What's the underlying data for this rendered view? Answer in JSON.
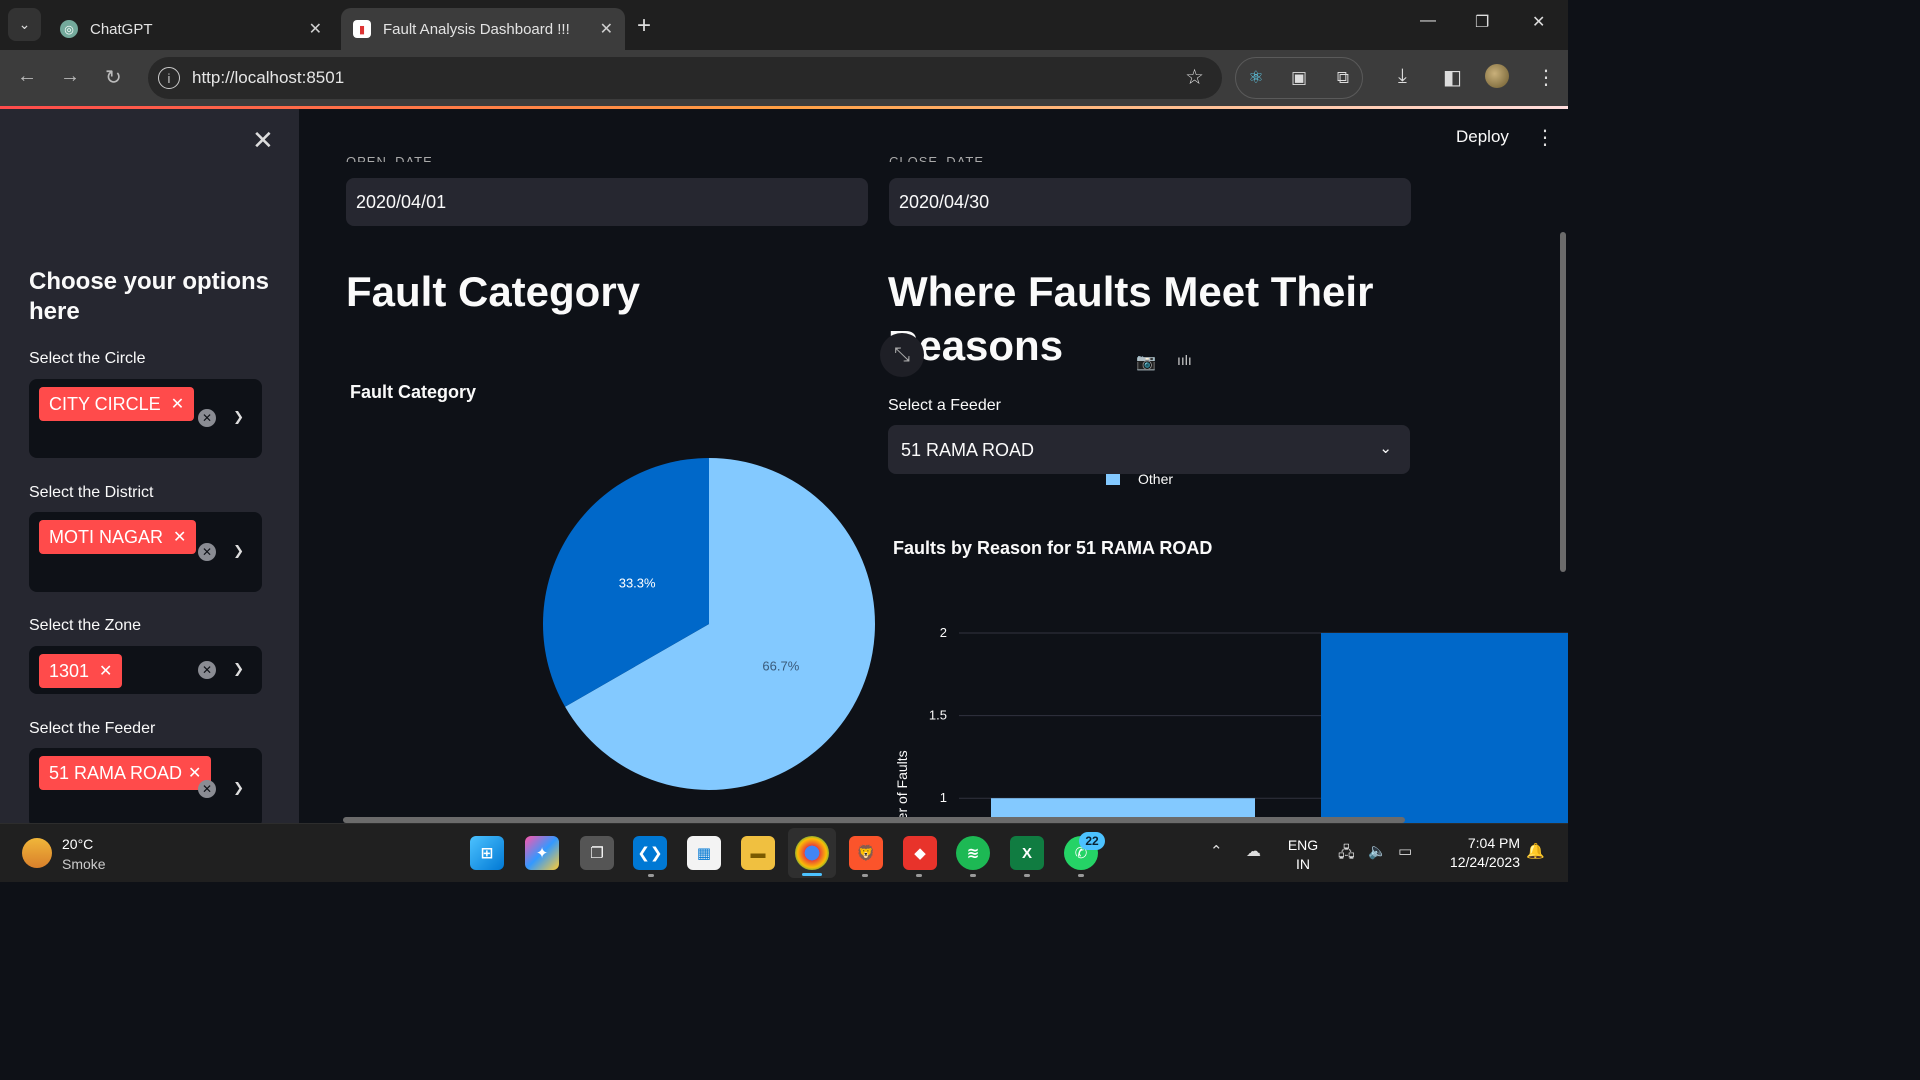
{
  "browser": {
    "tabs": [
      {
        "title": "ChatGPT",
        "icon": "chatgpt-icon"
      },
      {
        "title": "Fault Analysis Dashboard !!!",
        "icon": "bar-chart-icon"
      }
    ],
    "url": "http://localhost:8501"
  },
  "sidebar": {
    "title": "Choose your options here",
    "filters": [
      {
        "label": "Select the Circle",
        "value": "CITY CIRCLE"
      },
      {
        "label": "Select the District",
        "value": "MOTI NAGAR"
      },
      {
        "label": "Select the Zone",
        "value": "1301"
      },
      {
        "label": "Select the Feeder",
        "value": "51 RAMA ROAD"
      }
    ]
  },
  "header": {
    "deploy_label": "Deploy"
  },
  "dates": {
    "open_label": "OPEN_DATE",
    "open_value": "2020/04/01",
    "close_label": "CLOSE_DATE",
    "close_value": "2020/04/30"
  },
  "left_section": {
    "heading": "Fault Category"
  },
  "right_section": {
    "heading": "Where Faults Meet Their Reasons",
    "select_label": "Select a Feeder",
    "select_value": "51 RAMA ROAD",
    "legend_item": "Other"
  },
  "colors": {
    "accent": "#ff4b4b",
    "series_light": "#83c9ff",
    "series_dark": "#0068c9"
  },
  "chart_data": [
    {
      "type": "pie",
      "title": "Fault Category",
      "slices": [
        {
          "label": "",
          "value": 66.7,
          "text": "66.7%",
          "color": "#83c9ff"
        },
        {
          "label": "",
          "value": 33.3,
          "text": "33.3%",
          "color": "#0068c9"
        }
      ]
    },
    {
      "type": "bar",
      "title": "Faults by Reason for 51 RAMA ROAD",
      "ylabel": "Number of Faults",
      "xlabel": "",
      "yticks": [
        "1",
        "1.5",
        "2"
      ],
      "ylim": [
        0.85,
        2.0
      ],
      "grid": true,
      "bars": [
        {
          "value": 1,
          "color": "#83c9ff"
        },
        {
          "value": 2,
          "color": "#0068c9"
        }
      ]
    }
  ],
  "taskbar": {
    "weather_temp": "20°C",
    "weather_desc": "Smoke",
    "whatsapp_badge": "22",
    "lang_line1": "ENG",
    "lang_line2": "IN",
    "time": "7:04 PM",
    "date": "12/24/2023"
  }
}
